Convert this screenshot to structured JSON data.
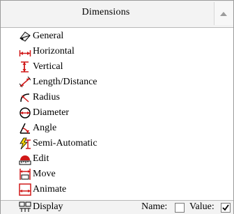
{
  "header": {
    "title": "Dimensions"
  },
  "items": [
    {
      "label": "General",
      "icon": "general-dimension-icon"
    },
    {
      "label": "Horizontal",
      "icon": "horizontal-dimension-icon"
    },
    {
      "label": "Vertical",
      "icon": "vertical-dimension-icon"
    },
    {
      "label": "Length/Distance",
      "icon": "length-distance-icon"
    },
    {
      "label": "Radius",
      "icon": "radius-icon"
    },
    {
      "label": "Diameter",
      "icon": "diameter-icon"
    },
    {
      "label": "Angle",
      "icon": "angle-icon"
    },
    {
      "label": "Semi-Automatic",
      "icon": "semi-automatic-icon"
    },
    {
      "label": "Edit",
      "icon": "edit-dimension-icon"
    },
    {
      "label": "Move",
      "icon": "move-dimension-icon"
    },
    {
      "label": "Animate",
      "icon": "animate-dimension-icon"
    }
  ],
  "footer": {
    "display_label": "Display",
    "name_label": "Name:",
    "name_checked": false,
    "value_label": "Value:",
    "value_checked": true
  },
  "colors": {
    "icon_red": "#d01818",
    "border": "#9a9a9a",
    "header_bg": "#f3f3f3"
  }
}
